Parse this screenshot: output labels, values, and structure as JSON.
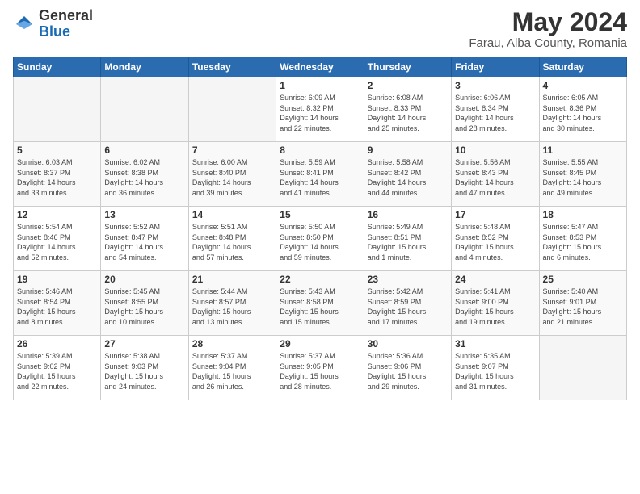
{
  "header": {
    "logo_general": "General",
    "logo_blue": "Blue",
    "title": "May 2024",
    "subtitle": "Farau, Alba County, Romania"
  },
  "weekdays": [
    "Sunday",
    "Monday",
    "Tuesday",
    "Wednesday",
    "Thursday",
    "Friday",
    "Saturday"
  ],
  "weeks": [
    [
      {
        "day": "",
        "info": ""
      },
      {
        "day": "",
        "info": ""
      },
      {
        "day": "",
        "info": ""
      },
      {
        "day": "1",
        "info": "Sunrise: 6:09 AM\nSunset: 8:32 PM\nDaylight: 14 hours\nand 22 minutes."
      },
      {
        "day": "2",
        "info": "Sunrise: 6:08 AM\nSunset: 8:33 PM\nDaylight: 14 hours\nand 25 minutes."
      },
      {
        "day": "3",
        "info": "Sunrise: 6:06 AM\nSunset: 8:34 PM\nDaylight: 14 hours\nand 28 minutes."
      },
      {
        "day": "4",
        "info": "Sunrise: 6:05 AM\nSunset: 8:36 PM\nDaylight: 14 hours\nand 30 minutes."
      }
    ],
    [
      {
        "day": "5",
        "info": "Sunrise: 6:03 AM\nSunset: 8:37 PM\nDaylight: 14 hours\nand 33 minutes."
      },
      {
        "day": "6",
        "info": "Sunrise: 6:02 AM\nSunset: 8:38 PM\nDaylight: 14 hours\nand 36 minutes."
      },
      {
        "day": "7",
        "info": "Sunrise: 6:00 AM\nSunset: 8:40 PM\nDaylight: 14 hours\nand 39 minutes."
      },
      {
        "day": "8",
        "info": "Sunrise: 5:59 AM\nSunset: 8:41 PM\nDaylight: 14 hours\nand 41 minutes."
      },
      {
        "day": "9",
        "info": "Sunrise: 5:58 AM\nSunset: 8:42 PM\nDaylight: 14 hours\nand 44 minutes."
      },
      {
        "day": "10",
        "info": "Sunrise: 5:56 AM\nSunset: 8:43 PM\nDaylight: 14 hours\nand 47 minutes."
      },
      {
        "day": "11",
        "info": "Sunrise: 5:55 AM\nSunset: 8:45 PM\nDaylight: 14 hours\nand 49 minutes."
      }
    ],
    [
      {
        "day": "12",
        "info": "Sunrise: 5:54 AM\nSunset: 8:46 PM\nDaylight: 14 hours\nand 52 minutes."
      },
      {
        "day": "13",
        "info": "Sunrise: 5:52 AM\nSunset: 8:47 PM\nDaylight: 14 hours\nand 54 minutes."
      },
      {
        "day": "14",
        "info": "Sunrise: 5:51 AM\nSunset: 8:48 PM\nDaylight: 14 hours\nand 57 minutes."
      },
      {
        "day": "15",
        "info": "Sunrise: 5:50 AM\nSunset: 8:50 PM\nDaylight: 14 hours\nand 59 minutes."
      },
      {
        "day": "16",
        "info": "Sunrise: 5:49 AM\nSunset: 8:51 PM\nDaylight: 15 hours\nand 1 minute."
      },
      {
        "day": "17",
        "info": "Sunrise: 5:48 AM\nSunset: 8:52 PM\nDaylight: 15 hours\nand 4 minutes."
      },
      {
        "day": "18",
        "info": "Sunrise: 5:47 AM\nSunset: 8:53 PM\nDaylight: 15 hours\nand 6 minutes."
      }
    ],
    [
      {
        "day": "19",
        "info": "Sunrise: 5:46 AM\nSunset: 8:54 PM\nDaylight: 15 hours\nand 8 minutes."
      },
      {
        "day": "20",
        "info": "Sunrise: 5:45 AM\nSunset: 8:55 PM\nDaylight: 15 hours\nand 10 minutes."
      },
      {
        "day": "21",
        "info": "Sunrise: 5:44 AM\nSunset: 8:57 PM\nDaylight: 15 hours\nand 13 minutes."
      },
      {
        "day": "22",
        "info": "Sunrise: 5:43 AM\nSunset: 8:58 PM\nDaylight: 15 hours\nand 15 minutes."
      },
      {
        "day": "23",
        "info": "Sunrise: 5:42 AM\nSunset: 8:59 PM\nDaylight: 15 hours\nand 17 minutes."
      },
      {
        "day": "24",
        "info": "Sunrise: 5:41 AM\nSunset: 9:00 PM\nDaylight: 15 hours\nand 19 minutes."
      },
      {
        "day": "25",
        "info": "Sunrise: 5:40 AM\nSunset: 9:01 PM\nDaylight: 15 hours\nand 21 minutes."
      }
    ],
    [
      {
        "day": "26",
        "info": "Sunrise: 5:39 AM\nSunset: 9:02 PM\nDaylight: 15 hours\nand 22 minutes."
      },
      {
        "day": "27",
        "info": "Sunrise: 5:38 AM\nSunset: 9:03 PM\nDaylight: 15 hours\nand 24 minutes."
      },
      {
        "day": "28",
        "info": "Sunrise: 5:37 AM\nSunset: 9:04 PM\nDaylight: 15 hours\nand 26 minutes."
      },
      {
        "day": "29",
        "info": "Sunrise: 5:37 AM\nSunset: 9:05 PM\nDaylight: 15 hours\nand 28 minutes."
      },
      {
        "day": "30",
        "info": "Sunrise: 5:36 AM\nSunset: 9:06 PM\nDaylight: 15 hours\nand 29 minutes."
      },
      {
        "day": "31",
        "info": "Sunrise: 5:35 AM\nSunset: 9:07 PM\nDaylight: 15 hours\nand 31 minutes."
      },
      {
        "day": "",
        "info": ""
      }
    ]
  ]
}
